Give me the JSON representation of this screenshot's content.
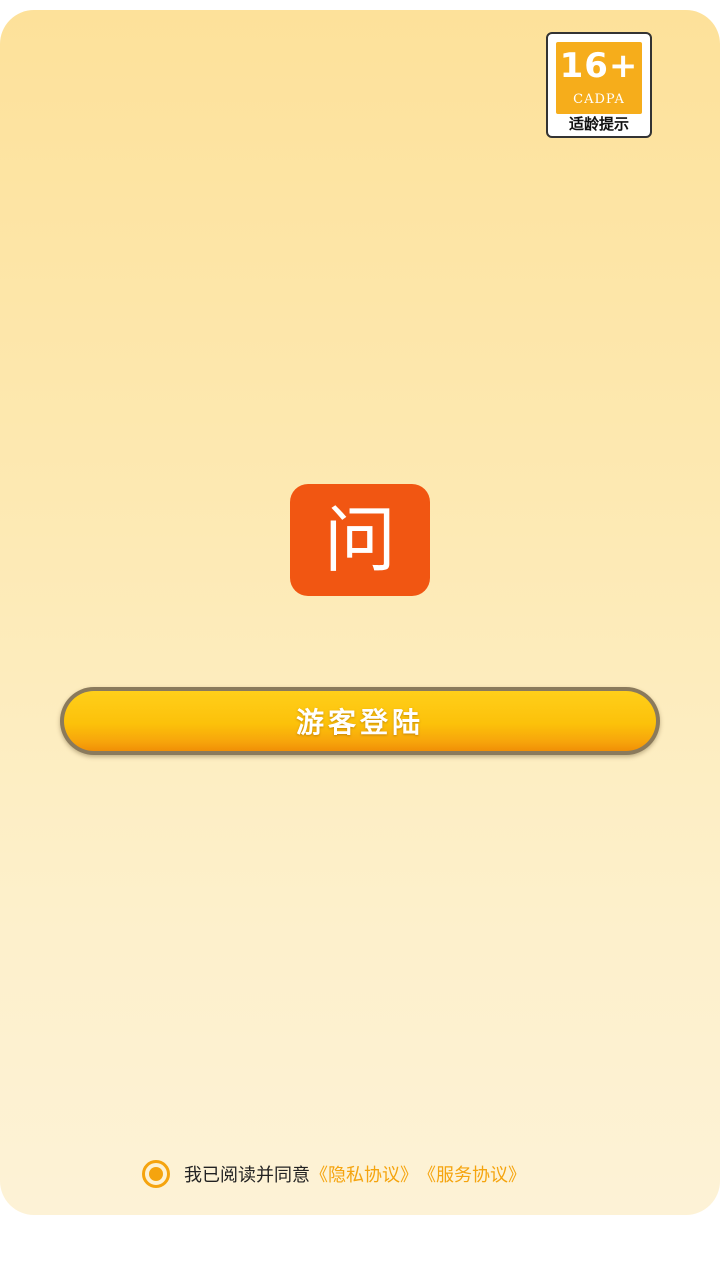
{
  "age_badge": {
    "rating": "16+",
    "org": "CADPA",
    "caption": "适龄提示"
  },
  "app_icon": {
    "char": "问",
    "color": "#f15612"
  },
  "login_button": {
    "label": "游客登陆"
  },
  "agreement": {
    "checked": true,
    "text": "我已阅读并同意",
    "privacy_link": "《隐私协议》",
    "service_link": "《服务协议》",
    "accent_color": "#f5a40e"
  }
}
